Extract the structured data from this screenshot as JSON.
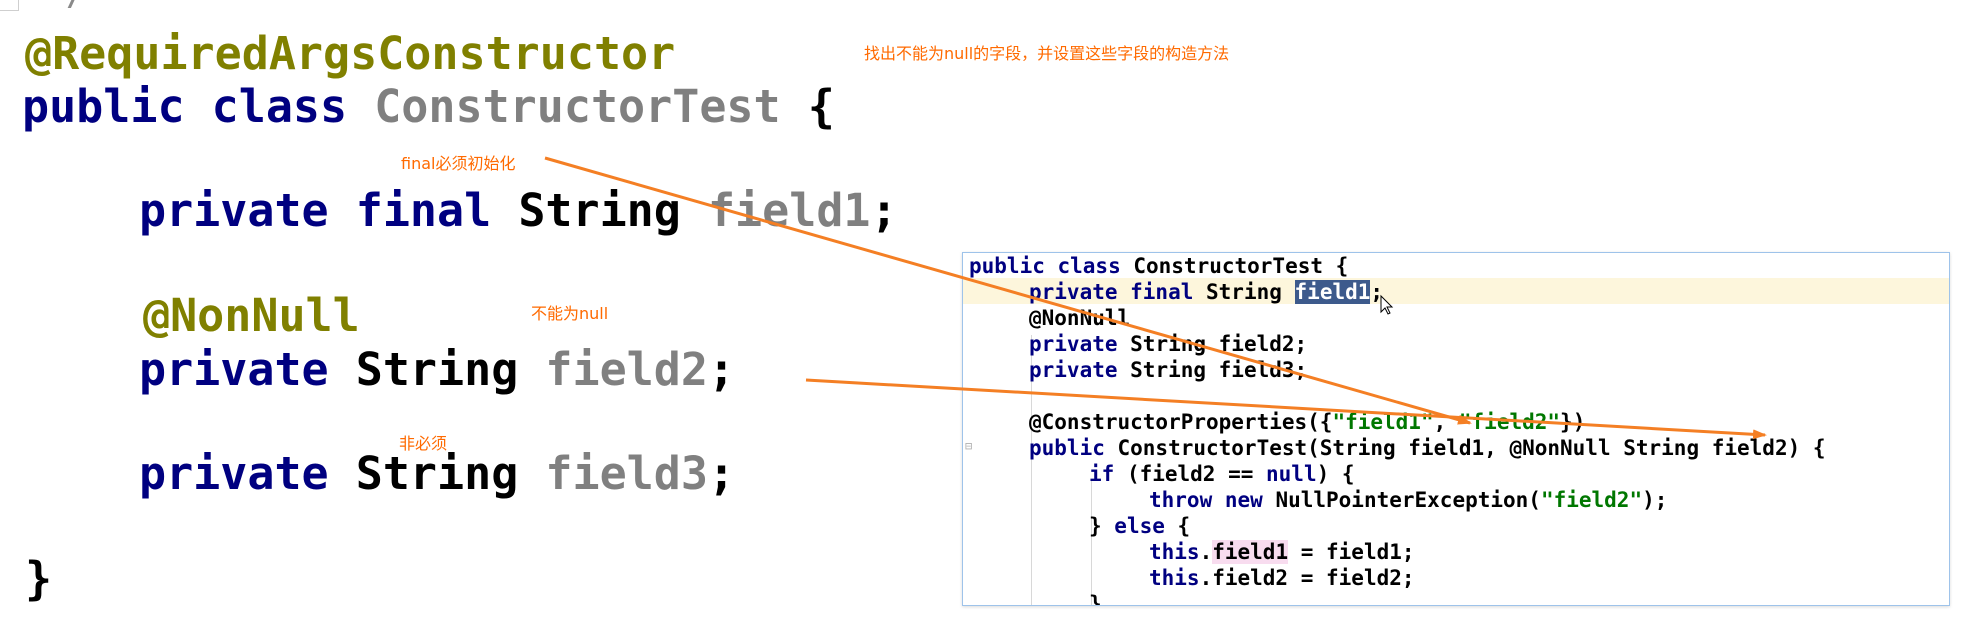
{
  "editor": {
    "top_fragment": "*/",
    "lines": {
      "annotation": "@RequiredArgsConstructor",
      "class_kw1": "public",
      "class_kw2": "class",
      "class_name": "ConstructorTest",
      "class_brace": "{",
      "f1_kw1": "private",
      "f1_kw2": "final",
      "f1_type": "String",
      "f1_name": "field1",
      "f1_semi": ";",
      "nonnull": "@NonNull",
      "f2_kw": "private",
      "f2_type": "String",
      "f2_name": "field2",
      "f2_semi": ";",
      "f3_kw": "private",
      "f3_type": "String",
      "f3_name": "field3",
      "f3_semi": ";",
      "close_brace": "}"
    }
  },
  "notes": {
    "top": "找出不能为null的字段，并设置这些字段的构造方法",
    "final": "final必须初始化",
    "nonnull": "不能为null",
    "optional": "非必须"
  },
  "popup": {
    "l1_kw": "public class",
    "l1_rest": " ConstructorTest {",
    "l2_kw": "private final",
    "l2_type": " String ",
    "l2_sel": "field1",
    "l2_end": ";",
    "l3": "@NonNull",
    "l4_kw": "private",
    "l4_rest": " String field2;",
    "l5_kw": "private",
    "l5_rest": " String field3;",
    "l7_pre": "@ConstructorProperties({",
    "l7_s1": "\"field1\"",
    "l7_mid": ", ",
    "l7_s2": "\"field2\"",
    "l7_end": "})",
    "l8_kw": "public",
    "l8_rest": " ConstructorTest(String field1, @NonNull String field2) {",
    "l9_kw": "if",
    "l9_rest": " (field2 == ",
    "l9_null": "null",
    "l9_end": ") {",
    "l10_kw": "throw new",
    "l10_rest": " NullPointerException(",
    "l10_str": "\"field2\"",
    "l10_end": ");",
    "l11_pre": "} ",
    "l11_kw": "else",
    "l11_end": " {",
    "l12_kw": "this",
    "l12_dot": ".",
    "l12_field": "field1",
    "l12_rest": " = field1;",
    "l13_kw": "this",
    "l13_rest": ".field2 = field2;",
    "l14": "}"
  },
  "colors": {
    "annotation": "#808000",
    "keyword": "#000080",
    "identifier": "#808080",
    "note": "#ff6a00",
    "string": "#007700",
    "selection": "#3d5a8c"
  }
}
